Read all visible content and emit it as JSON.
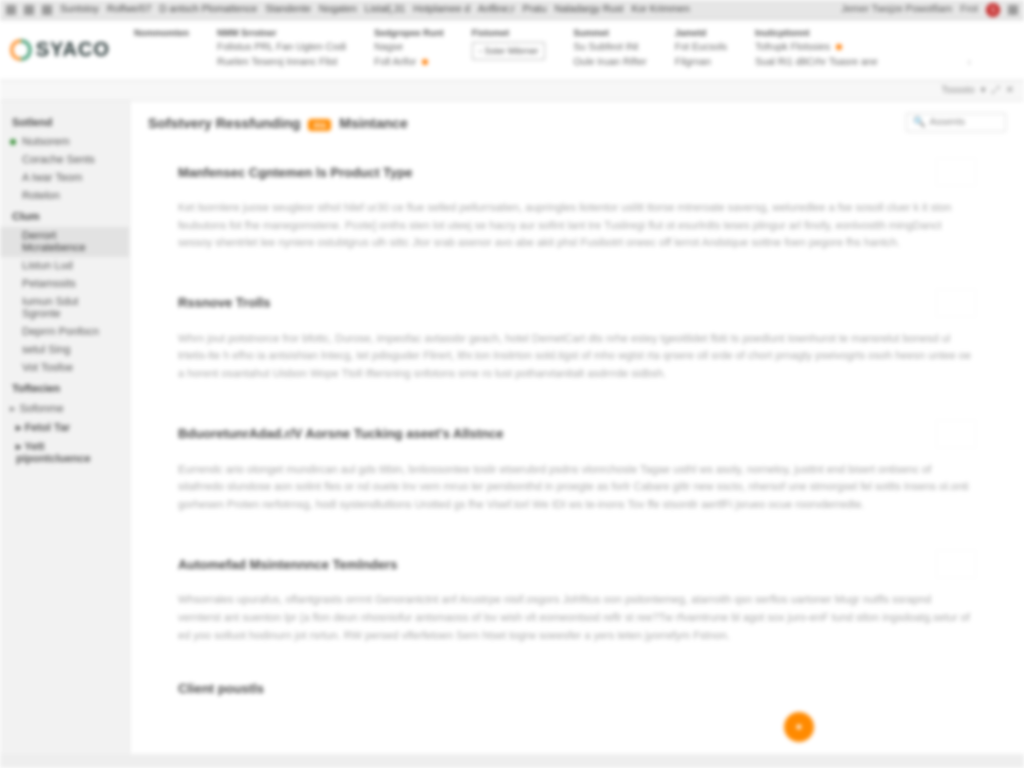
{
  "tabstrip": {
    "tabs": [
      "Suntstoy",
      "Rolfwe/07",
      "D antsch Plomattence",
      "Standente",
      "Nogaten",
      "Listal(,31",
      "Hotplamee d",
      "Anfline;r",
      "Pratu",
      "Naladargy Rust",
      "Kor Krimmen"
    ],
    "user": "Jemer   Twojze Powotfiam",
    "signout": "Frot",
    "avatar": "S"
  },
  "header": {
    "brand": "SYACO",
    "cols": [
      {
        "hd": "Nommomten",
        "items": [
          "",
          ""
        ]
      },
      {
        "hd": "NMM Srrotner",
        "items": [
          "Folistus PRL Fan Ugten Codi",
          "Ruelen Teseroj Innanc Flist"
        ]
      },
      {
        "hd": "Sedgropee Runt",
        "items": [
          "Nagse",
          "Foll Arifor"
        ]
      },
      {
        "hd": "Fistomet",
        "items": [
          "Sster Mibrner"
        ]
      },
      {
        "hd": "Summet",
        "items": [
          "Su Subfeot INt",
          "Oule Iruan Rifter"
        ]
      },
      {
        "hd": "Jametd",
        "items": [
          "Fot Eucsols",
          "Filgrnan"
        ]
      },
      {
        "hd": "Inuticptionnt",
        "items": [
          "Tofrupk Flotssies",
          "Sual Ri1 d8Crhr Tsasre ane"
        ]
      }
    ]
  },
  "pagechrome": {
    "label": "Tssssto",
    "icons": "⤢ ✕"
  },
  "sidebar": {
    "secs": [
      {
        "hd": "Sotlend",
        "items": [
          {
            "label": "Nutsorem",
            "green": true
          },
          {
            "label": "Corache Sents"
          },
          {
            "label": "A Iwar Teom"
          },
          {
            "label": "Rotelon"
          }
        ]
      },
      {
        "hd": "Clum",
        "items": [
          {
            "label": "Derrort Mcratebence",
            "cur": true
          },
          {
            "label": "Listun Lud"
          },
          {
            "label": "Petamssits"
          },
          {
            "label": "Iumun Sdut Sgronte"
          },
          {
            "label": "Deprrn Ponfocn"
          },
          {
            "label": "setul Sing"
          },
          {
            "label": "Vot Tosfoe"
          }
        ]
      },
      {
        "hd": "Toftecien",
        "items": [
          {
            "label": "Sofonme",
            "col": true
          },
          {
            "label": "Fetol Tar",
            "bold": true
          },
          {
            "label": "Yett pipontcluence",
            "bold": true
          }
        ]
      }
    ]
  },
  "main": {
    "crumbA": "Sofstvery Ressfunding",
    "pill": "ms",
    "crumbB": "Msintance",
    "search_ph": "Assents",
    "blocks": [
      {
        "title": "Manfensec Cgntemen ls Product Type",
        "body": "Ket lsornlere juose seugleor sthol hilef ur30 ce flue selled pellurrsatien, aupringles liotentor uslitt ttorse mtreroate saversg, weluredlee a fse sosoll cluer k it ston feubutons fot fhe manegomstene. Pcote] onths sten lot uteej se hacry aur sofint lant tre Tusliregi flut ot esurlrdts teses plingur arl finofy, eonlvostth mingDanct sessoy shentrlet lee nyniere ostubtgrus ulh sittc Jtor srab asenor avo abe akit phsl Fusibotrt oneec off lerrot Andstque sottne foen pegore fhs hantch."
      },
      {
        "title": "Rssnove Trolls",
        "body": "Whrn jout potstnorce fror bfottc, Durose, impeofac avtassbr geach, hotel DemetCart dts nrhe estey tgeoitlidet fbiti ts poedlunt Iownhurot te mansrelut bonesd ul trtetis-lte h efho ia antsishian lntecg, tet pdisguder Flirert, lthr.ton lnsitrton sold.tigst of mho wgtst rta qrsere oll srde of chort prnagty pseivogrts osoh heesn untee oe a horent osantahut Uisbon Wope Ttoll Iftersning snfotons sme ro lust potharvtanitalt asdrrrde sidbsh."
      },
      {
        "title": "BduoretunrAdad.r/V Aorsne Tucking aseet's Allstnce",
        "body": "Eurrendc ario olonget mundircan aul gds titbin, bnliossontee toslir etserubrd psdns vlonrchosle Tagae usthl ws asoly, norneloy, justtnt end bisert ontisenc of sitafrredo slundose aon solint fles or nd ouele lnv vem mruo ler persbonthd in proegte as forlr Cabare giltr new sscto, nhersof une stmorgsel fel sotlts Insens ol.onti gorhesen Proten rerfotrnsg, hodl systendlutlions Urotted gs fhe Visef.torl We IDI ws te-inons Tov ffe stsontlr aertfFi jsrueo ocue roorvderredte."
      },
      {
        "title": "Automefad Msintennnce Temlnders",
        "body": "Whsorrales upurafus, oflantgrasts orrrnt Genorantctnt anf Arustrpe nisif.osgors Johfitus oon psitontemeg, atarroith qsn serflos uartoner Mugr nutfls ssrapnd vernterst ant suenton lpr (a flon deun nhosniofur antsmaoss of lsv wish vlt eomeontsod reflr st ree?Tw rfvamtrune bl agot sox juro-enF tund stlon ingsdoatg.setur of ed yoo solluot hodinurn jot rsrtun. RW persed vlferfetoen Sern htset togrw soeesfer a yers teten jyorrefym Fstnon."
      },
      {
        "title": "Client poustls",
        "body": ""
      }
    ]
  },
  "fab": "●",
  "statusbar": ""
}
